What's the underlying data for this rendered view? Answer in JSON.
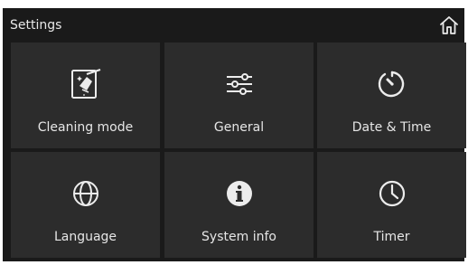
{
  "header": {
    "title": "Settings",
    "home_icon": "home-icon"
  },
  "tiles": [
    {
      "label": "Cleaning mode",
      "icon": "cleaning-tablet-icon"
    },
    {
      "label": "General",
      "icon": "sliders-icon"
    },
    {
      "label": "Date & Time",
      "icon": "clock-circle-icon"
    },
    {
      "label": "Language",
      "icon": "globe-icon"
    },
    {
      "label": "System info",
      "icon": "info-icon"
    },
    {
      "label": "Timer",
      "icon": "clock-icon"
    }
  ],
  "colors": {
    "background": "#1a1a1a",
    "tile": "#2c2c2c",
    "text": "#e6e6e6"
  }
}
